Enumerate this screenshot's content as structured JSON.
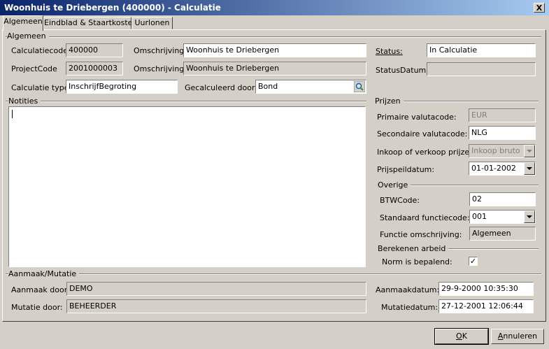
{
  "window": {
    "title": "Woonhuis te Driebergen (400000) - Calculatie",
    "close": "X"
  },
  "tabs": [
    "Algemeen",
    "Eindblad & Staartkosten",
    "Uurlonen"
  ],
  "algemeen": {
    "group": "Algemeen",
    "calculatiecode_label": "Calculatiecode:",
    "calculatiecode": "400000",
    "omschrijving_label": "Omschrijving:",
    "omschrijving": "Woonhuis te Driebergen",
    "projectcode_label": "ProjectCode",
    "projectcode": "2001000003",
    "omschrijving2_label": "Omschrijving:",
    "omschrijving2": "Woonhuis te Driebergen",
    "calculatietype_label": "Calculatie type:",
    "calculatietype": "InschrijfBegroting",
    "gecalculeerd_label": "Gecalculeerd door:",
    "gecalculeerd": "Bond",
    "status_label": "Status:",
    "status": "In Calculatie",
    "statusdatum_label": "StatusDatum:",
    "statusdatum": ""
  },
  "notities": {
    "label": "Notities",
    "text": ""
  },
  "prijzen": {
    "group": "Prijzen",
    "primaire_label": "Primaire valutacode:",
    "primaire": "EUR",
    "secundaire_label": "Secondaire valutacode:",
    "secundaire": "NLG",
    "inkoop_label": "Inkoop of verkoop prijzen:",
    "inkoop": "Inkoop bruto",
    "prijspeil_label": "Prijspeildatum:",
    "prijspeil": "01-01-2002"
  },
  "overige": {
    "group": "Overige",
    "btw_label": "BTWCode:",
    "btw": "02",
    "functiecode_label": "Standaard functiecode:",
    "functiecode": "001",
    "functieoms_label": "Functie omschrijving:",
    "functieoms": "Algemeen"
  },
  "arbeid": {
    "group": "Berekenen arbeid",
    "norm_label": "Norm is bepalend:",
    "norm_checked": true,
    "check_glyph": "✓"
  },
  "mutatie": {
    "group": "Aanmaak/Mutatie",
    "aanmaak_door_label": "Aanmaak door:",
    "aanmaak_door": "DEMO",
    "mutatie_door_label": "Mutatie door:",
    "mutatie_door": "BEHEERDER",
    "aanmaakdatum_label": "Aanmaakdatum:",
    "aanmaakdatum": "29-9-2000 10:35:30",
    "mutatiedatum_label": "Mutatiedatum:",
    "mutatiedatum": "27-12-2001 12:06:44"
  },
  "buttons": {
    "ok_prefix": "",
    "ok_key": "O",
    "ok_rest": "K",
    "cancel_prefix": "",
    "cancel_key": "A",
    "cancel_rest": "nnuleren"
  },
  "icons": {
    "lookup": "magnifier-icon",
    "dropdown": "chevron-down-icon",
    "close": "close-icon"
  }
}
